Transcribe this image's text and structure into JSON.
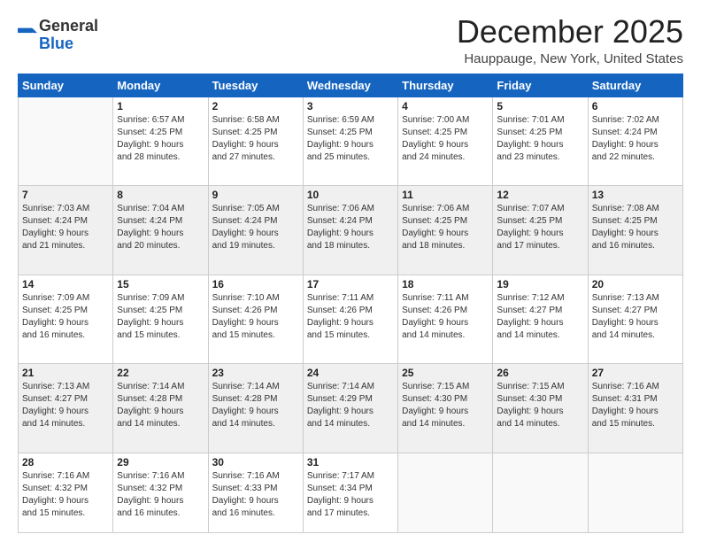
{
  "logo": {
    "general": "General",
    "blue": "Blue"
  },
  "title": "December 2025",
  "location": "Hauppauge, New York, United States",
  "days_of_week": [
    "Sunday",
    "Monday",
    "Tuesday",
    "Wednesday",
    "Thursday",
    "Friday",
    "Saturday"
  ],
  "weeks": [
    [
      {
        "num": "",
        "sunrise": "",
        "sunset": "",
        "daylight": ""
      },
      {
        "num": "1",
        "sunrise": "Sunrise: 6:57 AM",
        "sunset": "Sunset: 4:25 PM",
        "daylight": "Daylight: 9 hours and 28 minutes."
      },
      {
        "num": "2",
        "sunrise": "Sunrise: 6:58 AM",
        "sunset": "Sunset: 4:25 PM",
        "daylight": "Daylight: 9 hours and 27 minutes."
      },
      {
        "num": "3",
        "sunrise": "Sunrise: 6:59 AM",
        "sunset": "Sunset: 4:25 PM",
        "daylight": "Daylight: 9 hours and 25 minutes."
      },
      {
        "num": "4",
        "sunrise": "Sunrise: 7:00 AM",
        "sunset": "Sunset: 4:25 PM",
        "daylight": "Daylight: 9 hours and 24 minutes."
      },
      {
        "num": "5",
        "sunrise": "Sunrise: 7:01 AM",
        "sunset": "Sunset: 4:25 PM",
        "daylight": "Daylight: 9 hours and 23 minutes."
      },
      {
        "num": "6",
        "sunrise": "Sunrise: 7:02 AM",
        "sunset": "Sunset: 4:24 PM",
        "daylight": "Daylight: 9 hours and 22 minutes."
      }
    ],
    [
      {
        "num": "7",
        "sunrise": "Sunrise: 7:03 AM",
        "sunset": "Sunset: 4:24 PM",
        "daylight": "Daylight: 9 hours and 21 minutes."
      },
      {
        "num": "8",
        "sunrise": "Sunrise: 7:04 AM",
        "sunset": "Sunset: 4:24 PM",
        "daylight": "Daylight: 9 hours and 20 minutes."
      },
      {
        "num": "9",
        "sunrise": "Sunrise: 7:05 AM",
        "sunset": "Sunset: 4:24 PM",
        "daylight": "Daylight: 9 hours and 19 minutes."
      },
      {
        "num": "10",
        "sunrise": "Sunrise: 7:06 AM",
        "sunset": "Sunset: 4:24 PM",
        "daylight": "Daylight: 9 hours and 18 minutes."
      },
      {
        "num": "11",
        "sunrise": "Sunrise: 7:06 AM",
        "sunset": "Sunset: 4:25 PM",
        "daylight": "Daylight: 9 hours and 18 minutes."
      },
      {
        "num": "12",
        "sunrise": "Sunrise: 7:07 AM",
        "sunset": "Sunset: 4:25 PM",
        "daylight": "Daylight: 9 hours and 17 minutes."
      },
      {
        "num": "13",
        "sunrise": "Sunrise: 7:08 AM",
        "sunset": "Sunset: 4:25 PM",
        "daylight": "Daylight: 9 hours and 16 minutes."
      }
    ],
    [
      {
        "num": "14",
        "sunrise": "Sunrise: 7:09 AM",
        "sunset": "Sunset: 4:25 PM",
        "daylight": "Daylight: 9 hours and 16 minutes."
      },
      {
        "num": "15",
        "sunrise": "Sunrise: 7:09 AM",
        "sunset": "Sunset: 4:25 PM",
        "daylight": "Daylight: 9 hours and 15 minutes."
      },
      {
        "num": "16",
        "sunrise": "Sunrise: 7:10 AM",
        "sunset": "Sunset: 4:26 PM",
        "daylight": "Daylight: 9 hours and 15 minutes."
      },
      {
        "num": "17",
        "sunrise": "Sunrise: 7:11 AM",
        "sunset": "Sunset: 4:26 PM",
        "daylight": "Daylight: 9 hours and 15 minutes."
      },
      {
        "num": "18",
        "sunrise": "Sunrise: 7:11 AM",
        "sunset": "Sunset: 4:26 PM",
        "daylight": "Daylight: 9 hours and 14 minutes."
      },
      {
        "num": "19",
        "sunrise": "Sunrise: 7:12 AM",
        "sunset": "Sunset: 4:27 PM",
        "daylight": "Daylight: 9 hours and 14 minutes."
      },
      {
        "num": "20",
        "sunrise": "Sunrise: 7:13 AM",
        "sunset": "Sunset: 4:27 PM",
        "daylight": "Daylight: 9 hours and 14 minutes."
      }
    ],
    [
      {
        "num": "21",
        "sunrise": "Sunrise: 7:13 AM",
        "sunset": "Sunset: 4:27 PM",
        "daylight": "Daylight: 9 hours and 14 minutes."
      },
      {
        "num": "22",
        "sunrise": "Sunrise: 7:14 AM",
        "sunset": "Sunset: 4:28 PM",
        "daylight": "Daylight: 9 hours and 14 minutes."
      },
      {
        "num": "23",
        "sunrise": "Sunrise: 7:14 AM",
        "sunset": "Sunset: 4:28 PM",
        "daylight": "Daylight: 9 hours and 14 minutes."
      },
      {
        "num": "24",
        "sunrise": "Sunrise: 7:14 AM",
        "sunset": "Sunset: 4:29 PM",
        "daylight": "Daylight: 9 hours and 14 minutes."
      },
      {
        "num": "25",
        "sunrise": "Sunrise: 7:15 AM",
        "sunset": "Sunset: 4:30 PM",
        "daylight": "Daylight: 9 hours and 14 minutes."
      },
      {
        "num": "26",
        "sunrise": "Sunrise: 7:15 AM",
        "sunset": "Sunset: 4:30 PM",
        "daylight": "Daylight: 9 hours and 14 minutes."
      },
      {
        "num": "27",
        "sunrise": "Sunrise: 7:16 AM",
        "sunset": "Sunset: 4:31 PM",
        "daylight": "Daylight: 9 hours and 15 minutes."
      }
    ],
    [
      {
        "num": "28",
        "sunrise": "Sunrise: 7:16 AM",
        "sunset": "Sunset: 4:32 PM",
        "daylight": "Daylight: 9 hours and 15 minutes."
      },
      {
        "num": "29",
        "sunrise": "Sunrise: 7:16 AM",
        "sunset": "Sunset: 4:32 PM",
        "daylight": "Daylight: 9 hours and 16 minutes."
      },
      {
        "num": "30",
        "sunrise": "Sunrise: 7:16 AM",
        "sunset": "Sunset: 4:33 PM",
        "daylight": "Daylight: 9 hours and 16 minutes."
      },
      {
        "num": "31",
        "sunrise": "Sunrise: 7:17 AM",
        "sunset": "Sunset: 4:34 PM",
        "daylight": "Daylight: 9 hours and 17 minutes."
      },
      {
        "num": "",
        "sunrise": "",
        "sunset": "",
        "daylight": ""
      },
      {
        "num": "",
        "sunrise": "",
        "sunset": "",
        "daylight": ""
      },
      {
        "num": "",
        "sunrise": "",
        "sunset": "",
        "daylight": ""
      }
    ]
  ]
}
